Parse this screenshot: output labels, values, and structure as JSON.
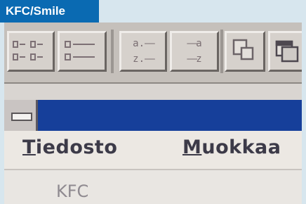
{
  "caption": "KFC/Smile",
  "toolbar": {
    "groups": [
      {
        "name": "view-group",
        "buttons": [
          "icon-view-button",
          "list-view-button"
        ]
      },
      {
        "name": "sort-group",
        "buttons": [
          "sort-ascending-button",
          "sort-descending-button"
        ]
      },
      {
        "name": "window-group",
        "buttons": [
          "cascade-windows-button",
          "tile-windows-button"
        ]
      }
    ],
    "sort_ascending": {
      "top": "a.",
      "bottom": "z."
    },
    "sort_descending": {
      "top": "a",
      "bottom": "z"
    }
  },
  "menubar": {
    "items": [
      {
        "label": "Tiedosto",
        "mnemonic": "T",
        "rest": "iedosto"
      },
      {
        "label": "Muokkaa",
        "mnemonic": "M",
        "rest": "uokkaa"
      }
    ]
  },
  "window": {
    "content_label": "KFC"
  },
  "colors": {
    "caption_bg": "#0a6ab2",
    "titlebar_bg": "#163f9a",
    "menubar_bg": "#ece8e3"
  }
}
